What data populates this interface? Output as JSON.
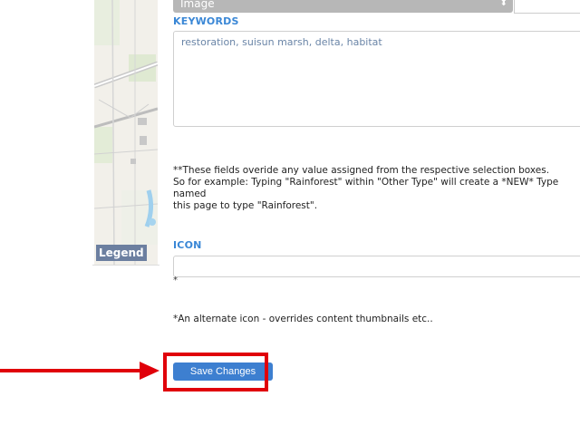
{
  "form": {
    "type_select_value": "Image",
    "keywords_label": "KEYWORDS",
    "keywords_value": "restoration, suisun marsh, delta, habitat",
    "override_note_line1": "**These fields overide any value assigned from the respective selection boxes.",
    "override_note_line2": "So for example: Typing \"Rainforest\" within \"Other Type\" will create a *NEW* Type named",
    "override_note_line3": "this page to type \"Rainforest\".",
    "icon_label": "ICON",
    "icon_value": "",
    "icon_asterisk": "*",
    "icon_note": "*An alternate icon - overrides content thumbnails etc..",
    "save_label": "Save Changes"
  },
  "map": {
    "legend_label": "Legend"
  },
  "colors": {
    "accent": "#3d7fd0",
    "label_blue": "#3a87d6",
    "highlight_red": "#e0000a"
  }
}
